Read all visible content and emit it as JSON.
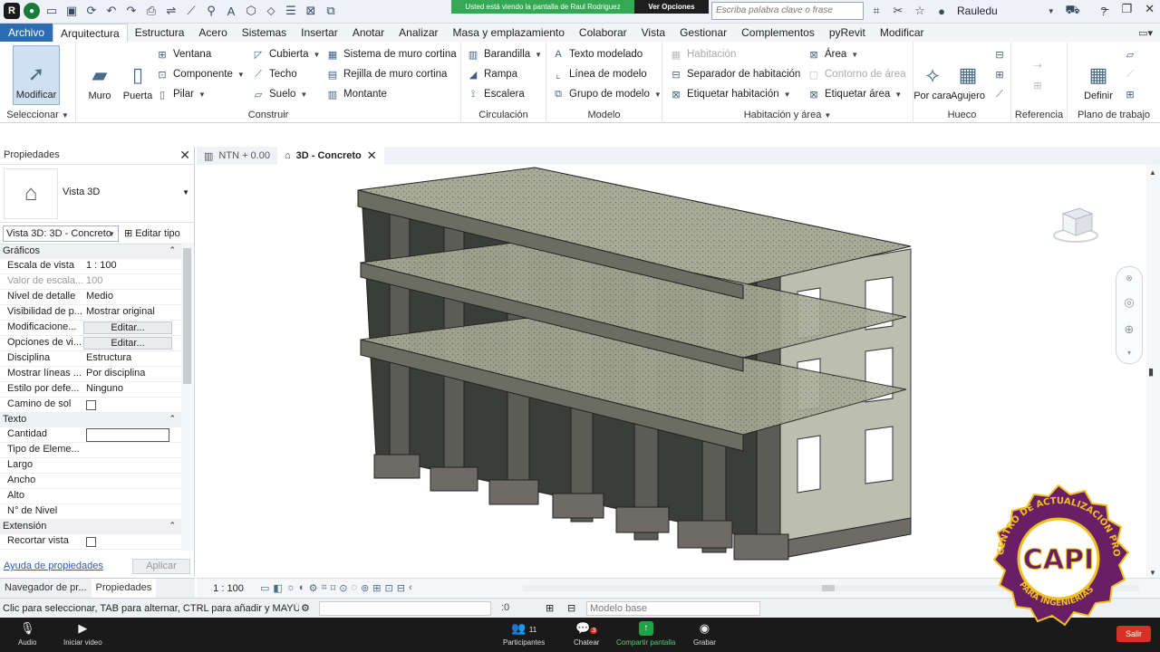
{
  "titlebar": {
    "app_logo": "R",
    "viewing_banner": "Usted está viendo la pantalla de Raul Rodriguez",
    "view_options": "Ver Opciones",
    "search_placeholder": "Escriba palabra clave o frase",
    "user": "Rauledu"
  },
  "ribbon_tabs": [
    "Archivo",
    "Arquitectura",
    "Estructura",
    "Acero",
    "Sistemas",
    "Insertar",
    "Anotar",
    "Analizar",
    "Masa y emplazamiento",
    "Colaborar",
    "Vista",
    "Gestionar",
    "Complementos",
    "pyRevit",
    "Modificar"
  ],
  "ribbon": {
    "select": {
      "modify": "Modificar",
      "label": "Seleccionar"
    },
    "build": {
      "label": "Construir",
      "wall": "Muro",
      "door": "Puerta",
      "window": "Ventana",
      "component": "Componente",
      "column": "Pilar",
      "roof": "Cubierta",
      "ceiling": "Techo",
      "floor": "Suelo",
      "curtain_system": "Sistema de muro cortina",
      "curtain_grid": "Rejilla de muro cortina",
      "mullion": "Montante"
    },
    "circulation": {
      "label": "Circulación",
      "railing": "Barandilla",
      "ramp": "Rampa",
      "stair": "Escalera"
    },
    "model": {
      "label": "Modelo",
      "model_text": "Texto modelado",
      "model_line": "Línea de modelo",
      "model_group": "Grupo de modelo"
    },
    "room_area": {
      "label": "Habitación y área",
      "room": "Habitación",
      "room_separator": "Separador de habitación",
      "tag_room": "Etiquetar habitación",
      "area": "Área",
      "area_boundary": "Contorno de área",
      "tag_area": "Etiquetar área"
    },
    "opening": {
      "label": "Hueco",
      "by_face": "Por cara",
      "shaft": "Agujero"
    },
    "datum": {
      "label": "Referencia"
    },
    "work_plane": {
      "label": "Plano de trabajo",
      "set": "Definir"
    }
  },
  "properties": {
    "title": "Propiedades",
    "type_name": "Vista 3D",
    "instance": "Vista 3D: 3D - Concreto",
    "edit_type": "Editar tipo",
    "sections": {
      "graphics": "Gráficos",
      "text": "Texto",
      "extents": "Extensión"
    },
    "graphics_rows": [
      {
        "key": "Escala de vista",
        "value": "1 : 100"
      },
      {
        "key": "Valor de escala...",
        "value": "100"
      },
      {
        "key": "Nivel de detalle",
        "value": "Medio"
      },
      {
        "key": "Visibilidad de p...",
        "value": "Mostrar original"
      },
      {
        "key": "Modificacione...",
        "value": "Editar..."
      },
      {
        "key": "Opciones de vi...",
        "value": "Editar..."
      },
      {
        "key": "Disciplina",
        "value": "Estructura"
      },
      {
        "key": "Mostrar líneas ...",
        "value": "Por disciplina"
      },
      {
        "key": "Estilo por defe...",
        "value": "Ninguno"
      },
      {
        "key": "Camino de sol",
        "value": ""
      }
    ],
    "text_rows": [
      {
        "key": "Cantidad"
      },
      {
        "key": "Tipo de Eleme..."
      },
      {
        "key": "Largo"
      },
      {
        "key": "Ancho"
      },
      {
        "key": "Alto"
      },
      {
        "key": "N° de Nivel"
      }
    ],
    "extents_rows": [
      {
        "key": "Recortar vista"
      }
    ],
    "help": "Ayuda de propiedades",
    "apply": "Aplicar"
  },
  "bottom_tabs": {
    "browser": "Navegador de pr...",
    "properties": "Propiedades"
  },
  "view_tabs": [
    {
      "label": "NTN + 0.00"
    },
    {
      "label": "3D - Concreto"
    }
  ],
  "view_bar": {
    "scale": "1 : 100"
  },
  "status": {
    "message": "Clic para seleccionar, TAB para alternar, CTRL para añadir y MAYÚ",
    "count": ":0",
    "model": "Modelo base"
  },
  "zoom": {
    "audio": "Audio",
    "video": "Iniciar video",
    "participants": "Participantes",
    "participants_count": "11",
    "chat": "Chatear",
    "chat_badge": "3",
    "share": "Compartir pantalla",
    "record": "Grabar",
    "leave": "Salir"
  },
  "stamp": {
    "text_top": "CENTRO DE ACTUALIZACIÓN PROFESIONAL",
    "text_bottom": "PARA INGENIERÍAS",
    "initials": "CAPI"
  },
  "colors": {
    "file_tab": "#2c6cb3",
    "banner_green": "#34a853",
    "zoom_bg": "#1a1a1a",
    "stamp_purple": "#6a1e66",
    "stamp_gold": "#f0c020"
  }
}
